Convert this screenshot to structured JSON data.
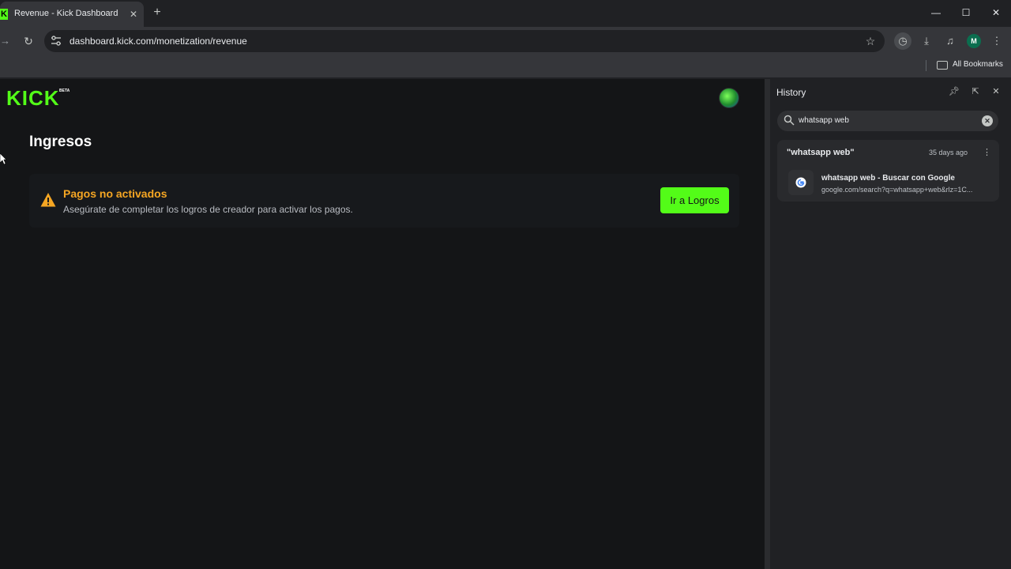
{
  "browser": {
    "tab_title": "Revenue - Kick Dashboard",
    "tab_favicon": "K",
    "new_tab_label": "+",
    "url": "dashboard.kick.com/monetization/revenue",
    "profile_initial": "M",
    "bookmarks_label": "All Bookmarks"
  },
  "page": {
    "logo_text": "KICK",
    "logo_badge": "BETA",
    "title": "Ingresos",
    "alert": {
      "title": "Pagos no activados",
      "description": "Asegúrate de completar los logros de creador para activar los pagos.",
      "button_label": "Ir a Logros"
    }
  },
  "history_panel": {
    "title": "History",
    "search_value": "whatsapp web",
    "result_group": {
      "heading": "\"whatsapp web\"",
      "date": "35 days ago",
      "entry_title": "whatsapp web - Buscar con Google",
      "entry_url": "google.com/search?q=whatsapp+web&rlz=1C..."
    }
  },
  "colors": {
    "accent": "#53fc18",
    "warning": "#f5a623",
    "page_bg": "#141517",
    "chrome_bg": "#202124"
  }
}
